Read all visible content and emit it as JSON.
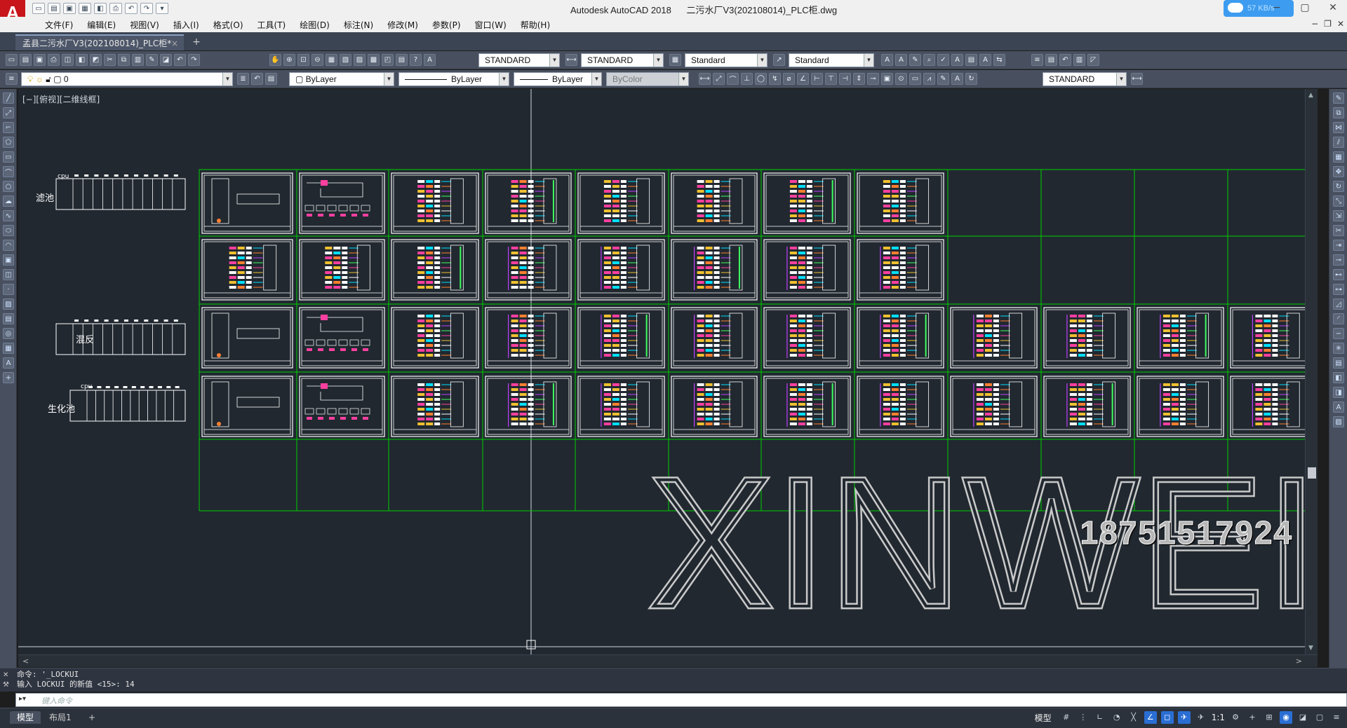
{
  "titlebar": {
    "app_name": "Autodesk AutoCAD 2018",
    "doc_name": "二污水厂V3(202108014)_PLC柜.dwg",
    "net_speed": "57 KB/s"
  },
  "menubar": {
    "items": [
      {
        "label": "文件(F)"
      },
      {
        "label": "编辑(E)"
      },
      {
        "label": "视图(V)"
      },
      {
        "label": "插入(I)"
      },
      {
        "label": "格式(O)"
      },
      {
        "label": "工具(T)"
      },
      {
        "label": "绘图(D)"
      },
      {
        "label": "标注(N)"
      },
      {
        "label": "修改(M)"
      },
      {
        "label": "参数(P)"
      },
      {
        "label": "窗口(W)"
      },
      {
        "label": "帮助(H)"
      }
    ]
  },
  "tabs": {
    "document_tab": "孟县二污水厂V3(202108014)_PLC柜*",
    "close": "×",
    "new": "+"
  },
  "toolbar1": {
    "text_style": "STANDARD",
    "dim_style": "STANDARD",
    "table_style": "Standard",
    "mleader_style": "Standard"
  },
  "toolbar2": {
    "layer": "0",
    "color": "ByLayer",
    "linetype": "ByLayer",
    "lineweight": "ByLayer",
    "plot_style": "ByColor",
    "multileader_style": "STANDARD"
  },
  "viewport": {
    "label": "[−][俯视][二维线框]",
    "rows": [
      {
        "name": "滤池",
        "cpu": "cpu",
        "has_plc_rack": true
      },
      {
        "name": "混反",
        "cpu": "",
        "has_plc_rack": true
      },
      {
        "name": "生化池",
        "cpu": "cpu",
        "has_plc_rack": true
      }
    ]
  },
  "watermark": {
    "text": "XINWEI",
    "phone": "18751517924"
  },
  "command": {
    "history_line1": "命令: '_LOCKUI",
    "history_line2": "输入 LOCKUI 的新值 <15>: 14",
    "placeholder": "键入命令"
  },
  "statusbar": {
    "tab_model": "模型",
    "tab_layout1": "布局1",
    "tab_add": "+",
    "model_label": "模型",
    "scale": "1:1"
  },
  "colors": {
    "drawing_bg": "#212830",
    "grid_green": "#00d000",
    "ui_dark": "#48505f",
    "title_red": "#c8141b"
  }
}
